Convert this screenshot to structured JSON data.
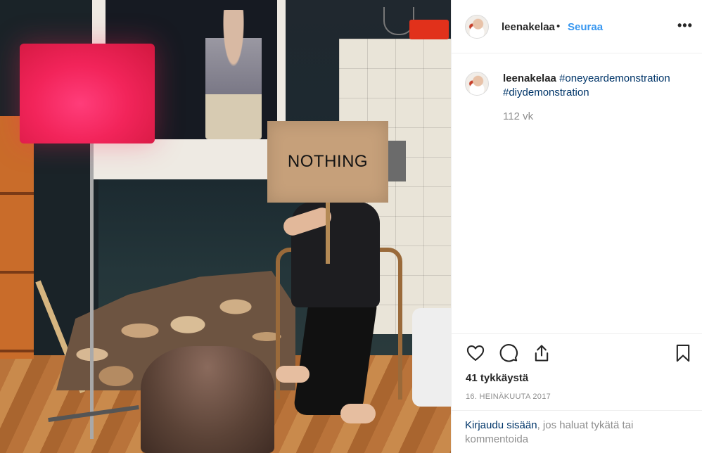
{
  "post": {
    "sign_text": "NOTHING"
  },
  "header": {
    "username": "leenakelaa",
    "dot": "•",
    "follow_label": "Seuraa",
    "more_label": "•••"
  },
  "caption": {
    "username": "leenakelaa",
    "hashtags": [
      "#oneyeardemonstration",
      "#diydemonstration"
    ],
    "age": "112 vk"
  },
  "actions": {
    "like_icon": "heart-icon",
    "comment_icon": "comment-icon",
    "share_icon": "share-icon",
    "save_icon": "bookmark-icon"
  },
  "stats": {
    "likes": "41 tykkäystä",
    "date": "16. HEINÄKUUTA 2017"
  },
  "login_prompt": {
    "link": "Kirjaudu sisään",
    "rest": ", jos haluat tykätä tai kommentoida"
  },
  "colors": {
    "link_blue": "#3897f0",
    "hashtag_navy": "#003569",
    "muted_gray": "#8e8e8e"
  }
}
